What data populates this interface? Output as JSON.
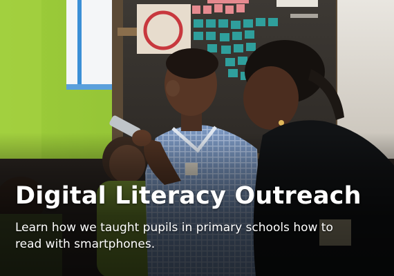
{
  "card": {
    "title": "Digital Literacy Outreach",
    "description": "Learn how we taught pupils in primary schools how to read with smartphones.",
    "title_color": "#ffffff",
    "overlay_color": "#000000"
  }
}
